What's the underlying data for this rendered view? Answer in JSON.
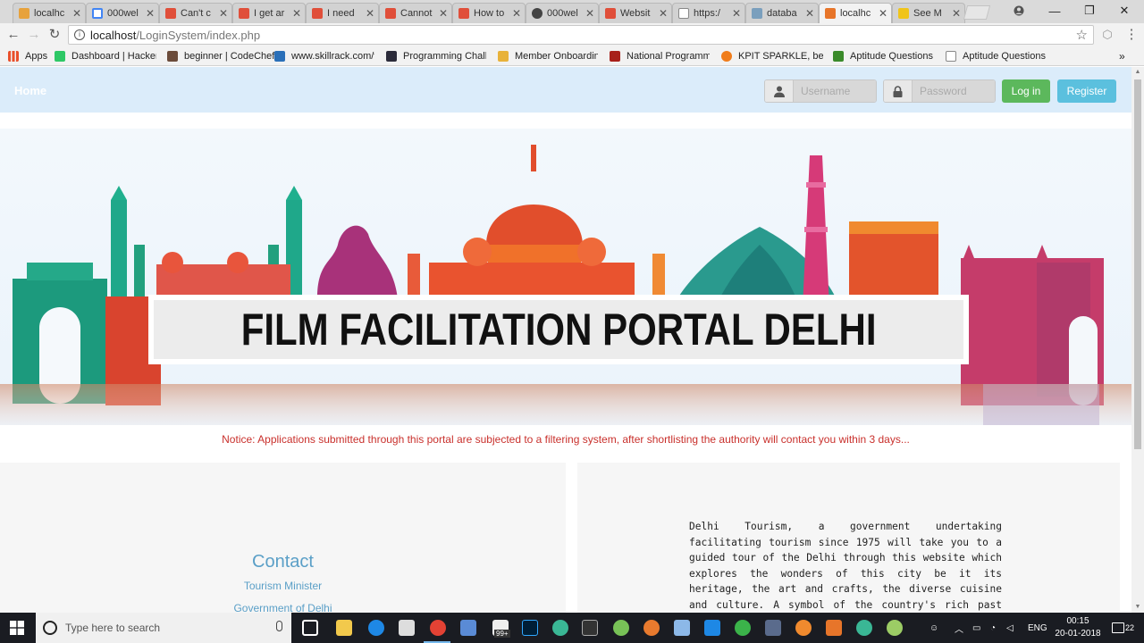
{
  "browser": {
    "tabs": [
      {
        "label": "localhc",
        "icon": "xampp-icon",
        "color": "#e7a23c"
      },
      {
        "label": "000wel",
        "icon": "google-icon",
        "color": "#4285f4"
      },
      {
        "label": "Can't c",
        "icon": "stack-overflow-icon",
        "color": "#e04f3a"
      },
      {
        "label": "I get ar",
        "icon": "stack-overflow-icon",
        "color": "#e04f3a"
      },
      {
        "label": "I need",
        "icon": "stack-overflow-icon",
        "color": "#e04f3a"
      },
      {
        "label": "Cannot",
        "icon": "stack-overflow-icon",
        "color": "#e04f3a"
      },
      {
        "label": "How to",
        "icon": "stack-overflow-icon",
        "color": "#e04f3a"
      },
      {
        "label": "000wel",
        "icon": "github-icon",
        "color": "#444444"
      },
      {
        "label": "Websit",
        "icon": "stack-overflow-icon",
        "color": "#e04f3a"
      },
      {
        "label": "https:/",
        "icon": "page-icon",
        "color": "#888888"
      },
      {
        "label": "databa",
        "icon": "chart-icon",
        "color": "#7a9fbd"
      },
      {
        "label": "localhc",
        "icon": "xampp-icon",
        "color": "#e7752a"
      },
      {
        "label": "See M",
        "icon": "bing-icon",
        "color": "#f0c419"
      }
    ],
    "url_host": "localhost",
    "url_path": "/LoginSystem/index.php",
    "bookmarks": [
      {
        "label": "Apps",
        "icon": "apps-icon",
        "color": "#e9502b"
      },
      {
        "label": "Dashboard | HackerR",
        "icon": "hackerrank-icon",
        "color": "#2ec866"
      },
      {
        "label": "beginner | CodeChef",
        "icon": "codechef-icon",
        "color": "#6b4b3a"
      },
      {
        "label": "www.skillrack.com/fa",
        "icon": "skillrack-icon",
        "color": "#2a6fb8"
      },
      {
        "label": "Programming Challe",
        "icon": "hackerearth-icon",
        "color": "#2b2b3a"
      },
      {
        "label": "Member Onboarding",
        "icon": "onboarding-icon",
        "color": "#e8b23a"
      },
      {
        "label": "National Programme",
        "icon": "nptel-icon",
        "color": "#a8201a"
      },
      {
        "label": "KPIT SPARKLE, beyon",
        "icon": "kpit-icon",
        "color": "#f07c1a"
      },
      {
        "label": "Aptitude Questions a",
        "icon": "indiabix-icon",
        "color": "#3a8a2a"
      },
      {
        "label": "Aptitude Questions a",
        "icon": "page-icon",
        "color": "#888888"
      }
    ]
  },
  "site": {
    "brand": "Home",
    "username_placeholder": "Username",
    "password_placeholder": "Password",
    "login_label": "Log in",
    "register_label": "Register",
    "banner_title": "FILM FACILITATION PORTAL DELHI",
    "notice": "Notice: Applications submitted through this portal are subjected to a filtering system, after shortlisting the authority will contact you within 3 days...",
    "contact": {
      "title": "Contact",
      "line1": "Tourism Minister",
      "line2": "Government of Delhi"
    },
    "about": "Delhi Tourism, a government undertaking facilitating tourism since 1975 will take you to a guided tour of the Delhi through this website which explores the wonders of this city be it its heritage, the art and crafts, the diverse cuisine and culture. A symbol of the country's rich past and thriving present, Delhi is a city"
  },
  "taskbar": {
    "search_placeholder": "Type here to search",
    "store_badge": "99+",
    "language": "ENG",
    "time": "00:15",
    "date": "20-01-2018",
    "notifications": "22"
  },
  "colors": {
    "navbar": "#dbecfa",
    "login_button": "#5cb85c",
    "register_button": "#5bc0de",
    "notice_text": "#c9302c",
    "contact_text": "#5a9fc7"
  }
}
